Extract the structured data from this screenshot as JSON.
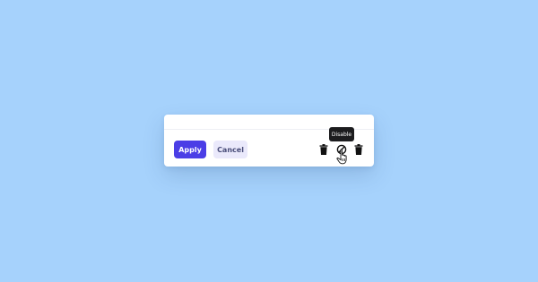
{
  "actions": {
    "apply_label": "Apply",
    "cancel_label": "Cancel"
  },
  "icons": [
    "trash-icon",
    "disable-icon",
    "trash-icon"
  ],
  "tooltip": {
    "text": "Disable"
  },
  "colors": {
    "background": "#a6d2fc",
    "primary": "#4b3ee6",
    "secondary_bg": "#eae9fb",
    "tooltip_bg": "#1c1c1e"
  }
}
